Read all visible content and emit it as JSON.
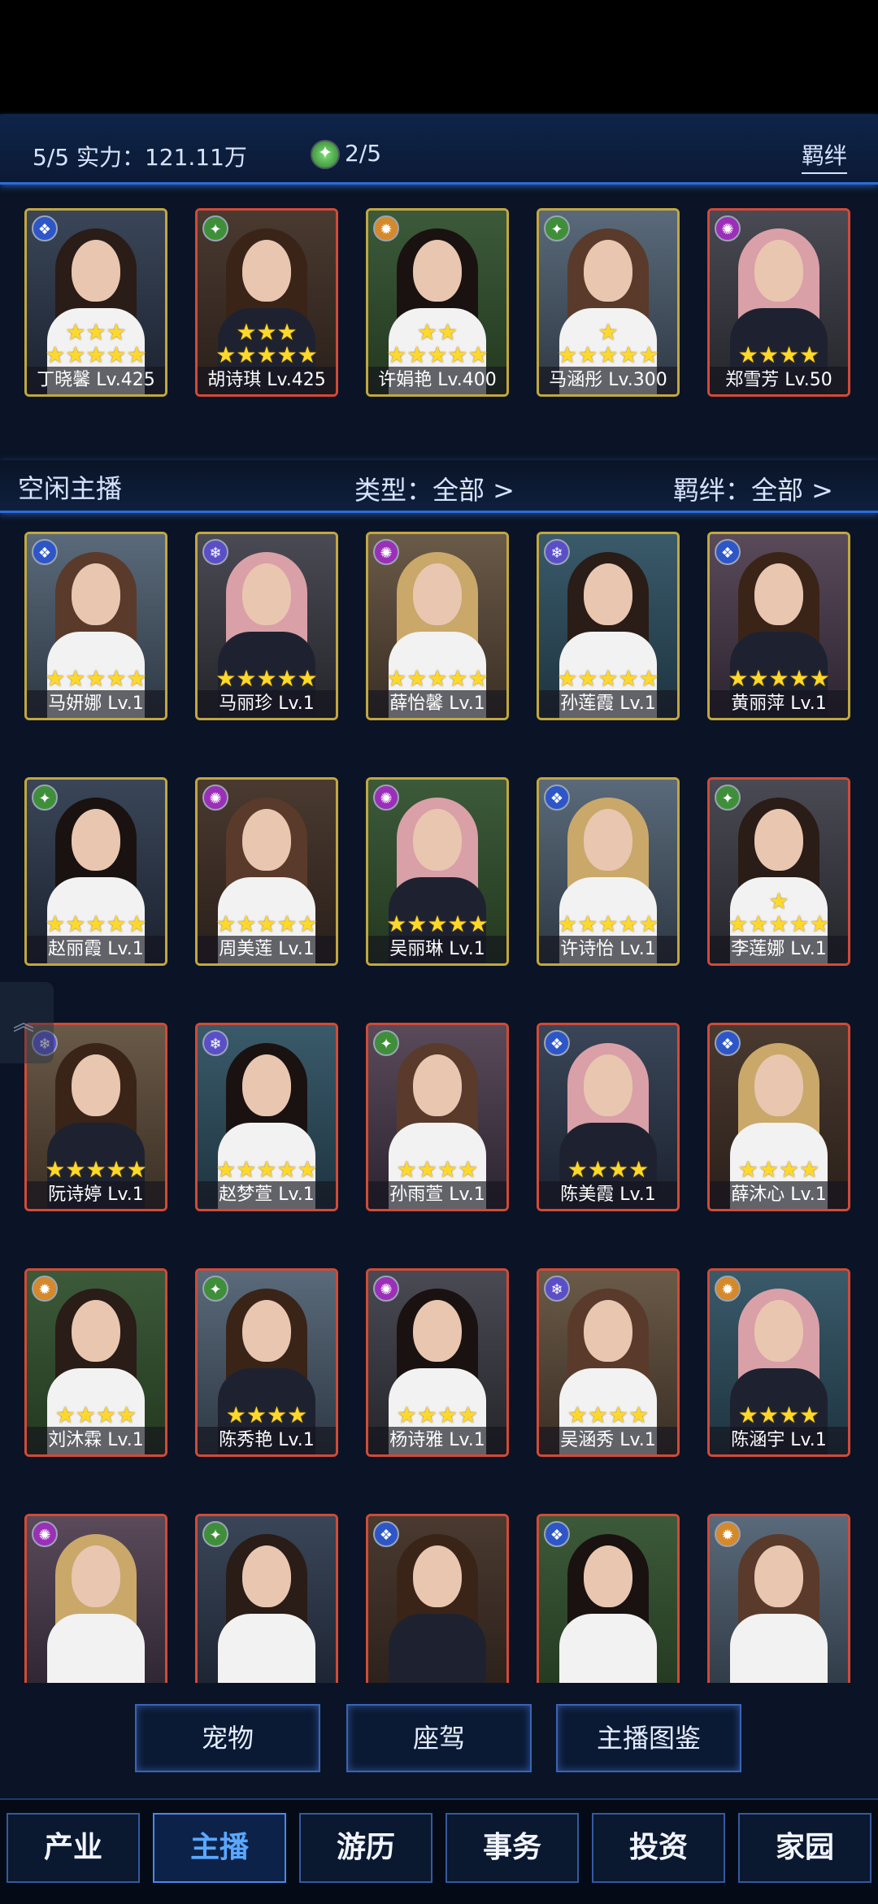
{
  "header": {
    "stat_text": "5/5  实力：121.11万",
    "gem_count": "2/5",
    "bond_label": "羁绊"
  },
  "team": [
    {
      "name": "丁晓馨 Lv.425",
      "stars": "★★★\n★★★★★",
      "element": "❖"
    },
    {
      "name": "胡诗琪 Lv.425",
      "stars": "★★★\n★★★★★",
      "element": "✦"
    },
    {
      "name": "许娟艳 Lv.400",
      "stars": "★★\n★★★★★",
      "element": "✹"
    },
    {
      "name": "马涵彤 Lv.300",
      "stars": "★\n★★★★★",
      "element": "✦"
    },
    {
      "name": "郑雪芳 Lv.50",
      "stars": "★★★★",
      "element": "✺"
    }
  ],
  "section": {
    "title": "空闲主播",
    "type_filter": "类型：全部 >",
    "bond_filter": "羁绊：全部 >"
  },
  "idle": [
    {
      "name": "马妍娜 Lv.1",
      "stars": "★★★★★",
      "element": "❖"
    },
    {
      "name": "马丽珍 Lv.1",
      "stars": "★★★★★",
      "element": "❄"
    },
    {
      "name": "薛怡馨 Lv.1",
      "stars": "★★★★★",
      "element": "✺"
    },
    {
      "name": "孙莲霞 Lv.1",
      "stars": "★★★★★",
      "element": "❄"
    },
    {
      "name": "黄丽萍 Lv.1",
      "stars": "★★★★★",
      "element": "❖"
    },
    {
      "name": "赵丽霞 Lv.1",
      "stars": "★★★★★",
      "element": "✦"
    },
    {
      "name": "周美莲 Lv.1",
      "stars": "★★★★★",
      "element": "✺"
    },
    {
      "name": "吴丽琳 Lv.1",
      "stars": "★★★★★",
      "element": "✺"
    },
    {
      "name": "许诗怡 Lv.1",
      "stars": "★★★★★",
      "element": "❖"
    },
    {
      "name": "李莲娜 Lv.1",
      "stars": "★\n★★★★★",
      "element": "✦"
    },
    {
      "name": "阮诗婷 Lv.1",
      "stars": "★★★★★",
      "element": "❄"
    },
    {
      "name": "赵梦萱 Lv.1",
      "stars": "★★★★★",
      "element": "❄"
    },
    {
      "name": "孙雨萱 Lv.1",
      "stars": "★★★★",
      "element": "✦"
    },
    {
      "name": "陈美霞 Lv.1",
      "stars": "★★★★",
      "element": "❖"
    },
    {
      "name": "薛沐心 Lv.1",
      "stars": "★★★★",
      "element": "❖"
    },
    {
      "name": "刘沐霖 Lv.1",
      "stars": "★★★★",
      "element": "✹"
    },
    {
      "name": "陈秀艳 Lv.1",
      "stars": "★★★★",
      "element": "✦"
    },
    {
      "name": "杨诗雅 Lv.1",
      "stars": "★★★★",
      "element": "✺"
    },
    {
      "name": "吴涵秀 Lv.1",
      "stars": "★★★★",
      "element": "❄"
    },
    {
      "name": "陈涵宇 Lv.1",
      "stars": "★★★★",
      "element": "✹"
    },
    {
      "name": "",
      "stars": "",
      "element": "✺"
    },
    {
      "name": "",
      "stars": "",
      "element": "✦"
    },
    {
      "name": "",
      "stars": "",
      "element": "❖"
    },
    {
      "name": "",
      "stars": "",
      "element": "❖"
    },
    {
      "name": "",
      "stars": "",
      "element": "✹"
    }
  ],
  "mid_buttons": [
    "宠物",
    "座驾",
    "主播图鉴"
  ],
  "nav": [
    "产业",
    "主播",
    "游历",
    "事务",
    "投资",
    "家园"
  ],
  "nav_active": "主播",
  "colors": {
    "accent": "#2e6bd8",
    "star": "#ffd92a",
    "active_tab": "#5aa8ff"
  }
}
